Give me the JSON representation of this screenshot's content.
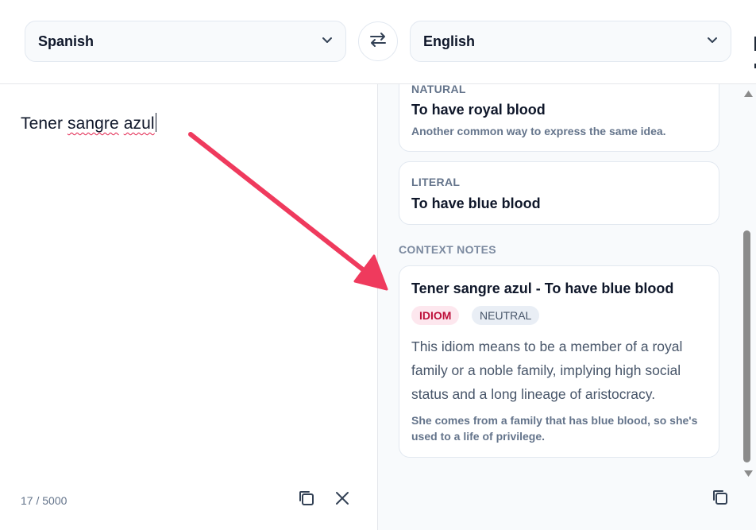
{
  "source_language": {
    "selected": "Spanish"
  },
  "target_language": {
    "selected": "English"
  },
  "input": {
    "text_before": "Tener ",
    "misspelled_1": "sangre",
    "space": " ",
    "misspelled_2": "azul",
    "char_count": "17 / 5000"
  },
  "results": {
    "natural": {
      "kicker": "NATURAL",
      "translation": "To have royal blood",
      "description": "Another common way to express the same idea."
    },
    "literal": {
      "kicker": "LITERAL",
      "translation": "To have blue blood"
    },
    "context_notes": {
      "section_label": "CONTEXT NOTES",
      "title": "Tener sangre azul - To have blue blood",
      "tags": [
        "IDIOM",
        "NEUTRAL"
      ],
      "body": "This idiom means to be a member of a royal family or a noble family, implying high social status and a long lineage of aristocracy.",
      "example": "She comes from a family that has blue blood, so she's used to a life of privilege."
    }
  },
  "icons": {
    "swap": "swap-arrows-icon",
    "copy": "copy-icon",
    "clear": "close-icon",
    "dropdown": "chevron-down-icon"
  },
  "colors": {
    "annotation_arrow": "#ef3a5d",
    "idiom_tag_bg": "#fde7ee",
    "idiom_tag_text": "#be123c"
  }
}
